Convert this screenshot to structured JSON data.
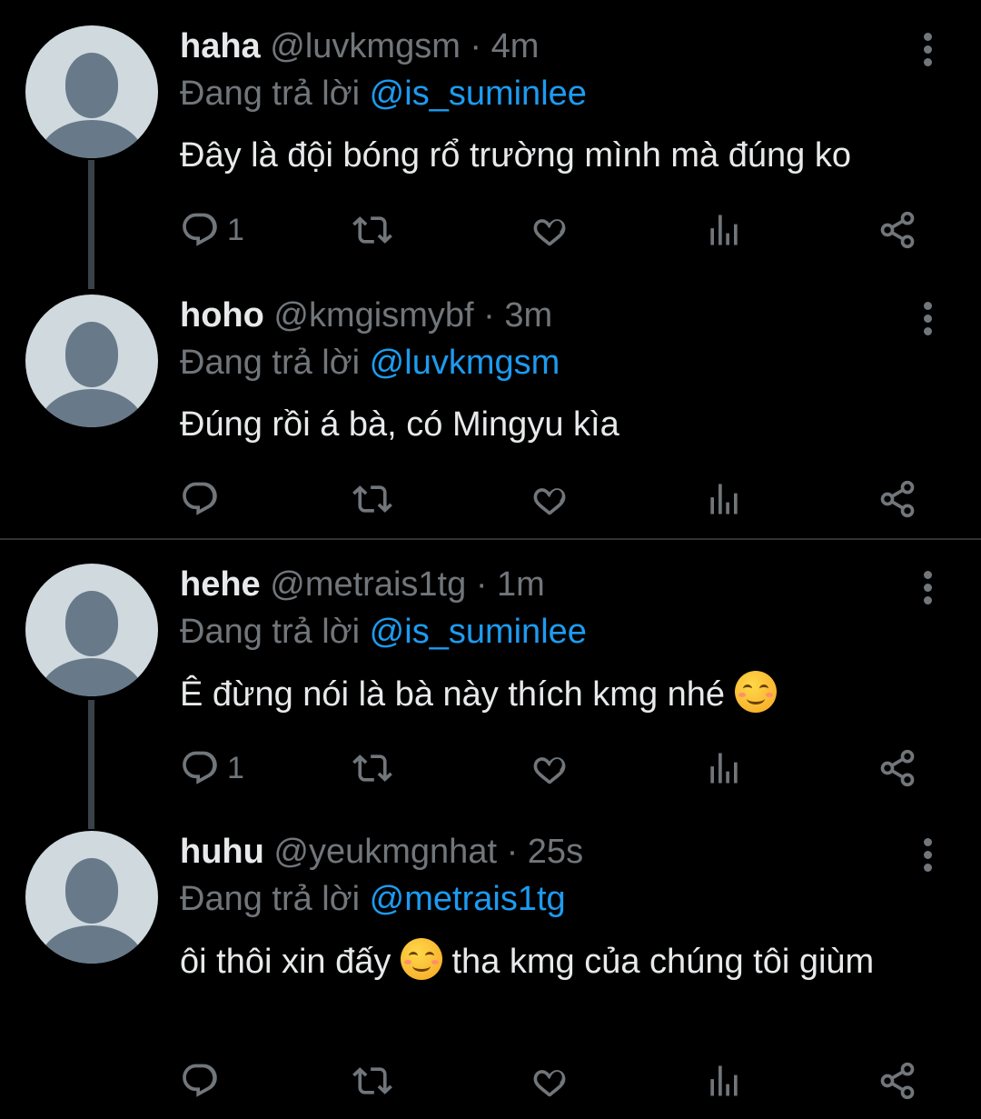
{
  "reply_prefix": "Đang trả lời",
  "tweets": [
    {
      "name": "haha",
      "handle": "@luvkmgsm",
      "time": "4m",
      "reply_to": "@is_suminlee",
      "text": "Đây là đội bóng rổ trường mình mà đúng ko",
      "reply_count": "1"
    },
    {
      "name": "hoho",
      "handle": "@kmgismybf",
      "time": "3m",
      "reply_to": "@luvkmgsm",
      "text": "Đúng rồi á bà, có Mingyu kìa",
      "reply_count": ""
    },
    {
      "name": "hehe",
      "handle": "@metrais1tg",
      "time": "1m",
      "reply_to": "@is_suminlee",
      "text_a": "Ê đừng nói là bà này thích kmg nhé",
      "emoji": "smiling-face-emoji",
      "reply_count": "1"
    },
    {
      "name": "huhu",
      "handle": "@yeukmgnhat",
      "time": "25s",
      "reply_to": "@metrais1tg",
      "text_a": "ôi thôi xin đấy",
      "emoji": "smiling-face-emoji",
      "text_b": "tha kmg của chúng tôi giùm",
      "reply_count": ""
    }
  ],
  "separator_dot": "·",
  "colors": {
    "background": "#000000",
    "text": "#e7e9ea",
    "muted": "#71767b",
    "mention": "#1d9bf0",
    "avatar_bg": "#cfd9de",
    "avatar_fg": "#68798a"
  },
  "icons": [
    "reply-icon",
    "retweet-icon",
    "like-icon",
    "views-icon",
    "share-icon",
    "more-icon"
  ]
}
